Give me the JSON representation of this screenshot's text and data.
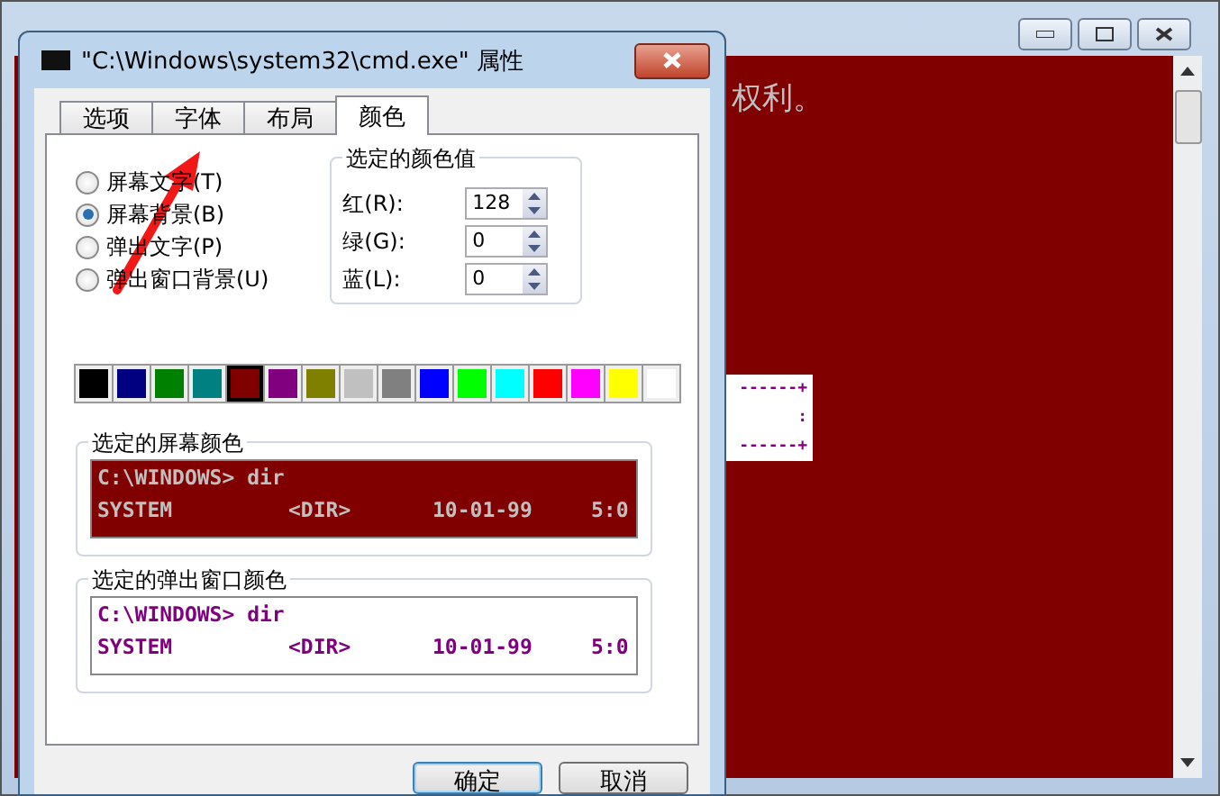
{
  "console_window": {
    "console_text": "权利。",
    "popup_fragment": [
      "------+",
      ":",
      "------+"
    ]
  },
  "dialog": {
    "title": "\"C:\\Windows\\system32\\cmd.exe\" 属性",
    "tabs": [
      {
        "label": "选项",
        "selected": false
      },
      {
        "label": "字体",
        "selected": false
      },
      {
        "label": "布局",
        "selected": false
      },
      {
        "label": "颜色",
        "selected": true
      }
    ],
    "targets": [
      {
        "label": "屏幕文字(T)",
        "selected": false
      },
      {
        "label": "屏幕背景(B)",
        "selected": true
      },
      {
        "label": "弹出文字(P)",
        "selected": false
      },
      {
        "label": "弹出窗口背景(U)",
        "selected": false
      }
    ],
    "color_values": {
      "title": "选定的颜色值",
      "fields": [
        {
          "label": "红(R):",
          "value": "128"
        },
        {
          "label": "绿(G):",
          "value": "0"
        },
        {
          "label": "蓝(L):",
          "value": "0"
        }
      ]
    },
    "swatches": [
      {
        "color": "#000000",
        "selected": false
      },
      {
        "color": "#000080",
        "selected": false
      },
      {
        "color": "#008000",
        "selected": false
      },
      {
        "color": "#008080",
        "selected": false
      },
      {
        "color": "#800000",
        "selected": true
      },
      {
        "color": "#800080",
        "selected": false
      },
      {
        "color": "#808000",
        "selected": false
      },
      {
        "color": "#c0c0c0",
        "selected": false
      },
      {
        "color": "#808080",
        "selected": false
      },
      {
        "color": "#0000ff",
        "selected": false
      },
      {
        "color": "#00ff00",
        "selected": false
      },
      {
        "color": "#00ffff",
        "selected": false
      },
      {
        "color": "#ff0000",
        "selected": false
      },
      {
        "color": "#ff00ff",
        "selected": false
      },
      {
        "color": "#ffff00",
        "selected": false
      },
      {
        "color": "#ffffff",
        "selected": false
      }
    ],
    "previews": [
      {
        "title": "选定的屏幕颜色",
        "kind": "screen",
        "lines": [
          [
            "C:\\WINDOWS> dir"
          ],
          [
            "SYSTEM",
            "<DIR>",
            "10-01-99",
            "5:0"
          ]
        ]
      },
      {
        "title": "选定的弹出窗口颜色",
        "kind": "popup",
        "lines": [
          [
            "C:\\WINDOWS> dir"
          ],
          [
            "SYSTEM",
            "<DIR>",
            "10-01-99",
            "5:0"
          ]
        ]
      }
    ],
    "buttons": [
      "确定",
      "取消"
    ]
  }
}
